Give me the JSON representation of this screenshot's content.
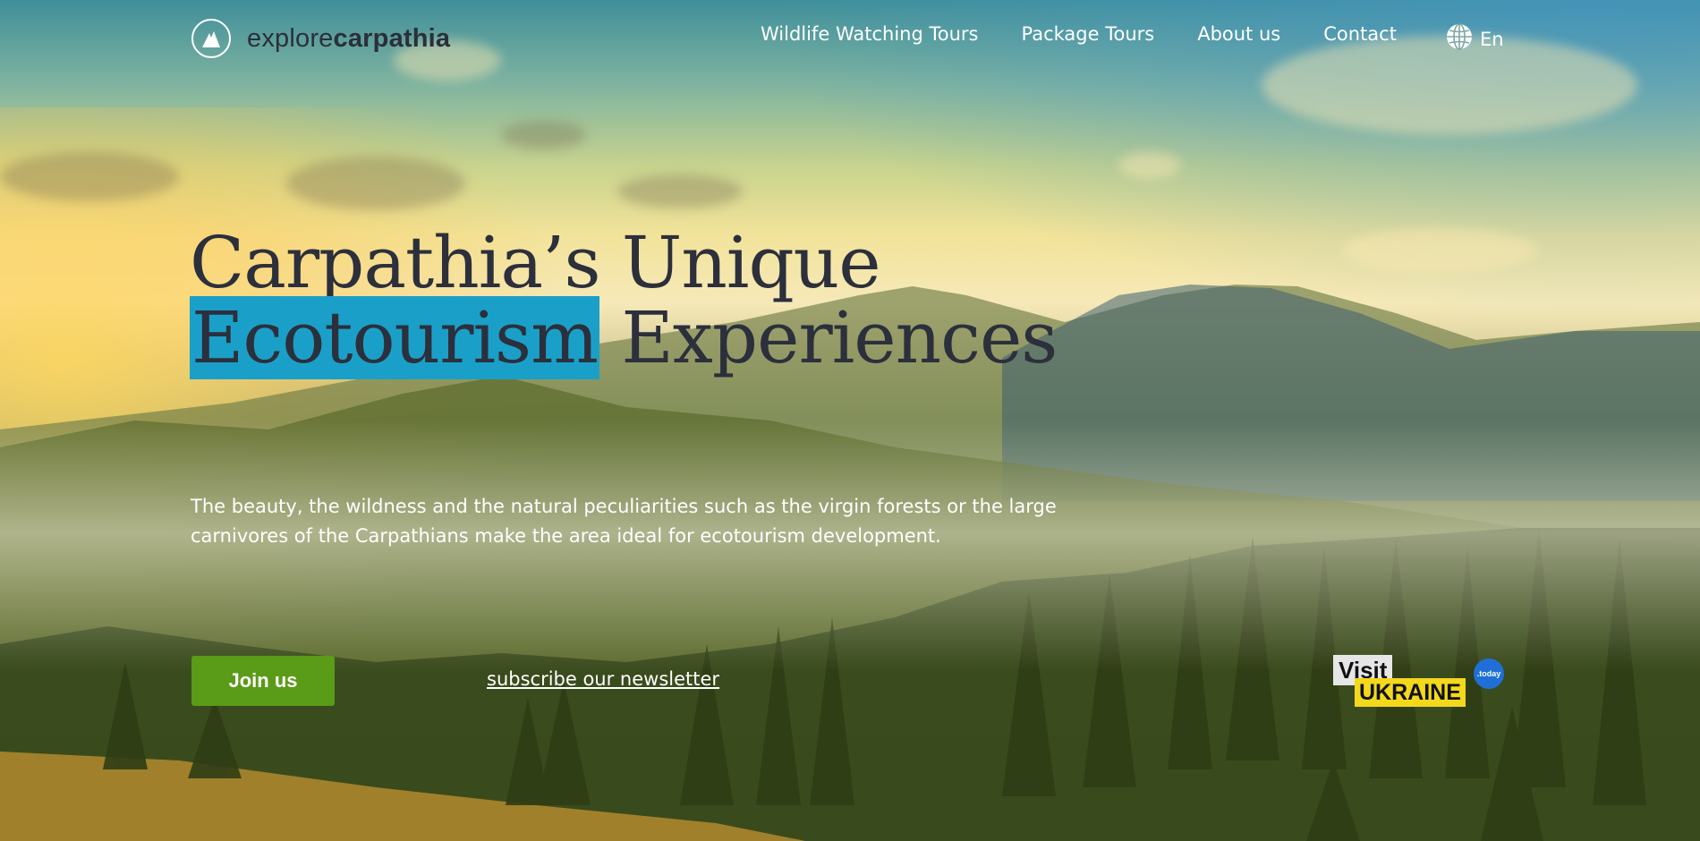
{
  "header": {
    "logo_text_light": "explore",
    "logo_text_bold": "carpathia",
    "logo_icon": "mountain-icon",
    "nav": [
      {
        "label": "Wildlife Watching Tours"
      },
      {
        "label": "Package Tours"
      },
      {
        "label": "About us"
      },
      {
        "label": "Contact"
      }
    ],
    "language": {
      "label": "En",
      "icon": "globe-icon"
    }
  },
  "hero": {
    "title_line1": "Carpathia’s Unique",
    "title_highlight": "Ecotourism",
    "title_rest": " Experiences",
    "description": "The beauty, the wildness and the natural peculiarities such as the virgin forests or the large carnivores of the Carpathians make the area ideal for ecotourism development.",
    "cta_label": "Join us",
    "newsletter_label": "subscribe our newsletter"
  },
  "badge": {
    "line1": "Visit",
    "line2": "UKRAINE",
    "circle_text": ".today"
  },
  "colors": {
    "highlight": "#1aa0c8",
    "cta": "#5a9b17",
    "heading": "#2c2f3c",
    "badge_yellow": "#f3d81c",
    "badge_blue": "#1f6fd6"
  }
}
